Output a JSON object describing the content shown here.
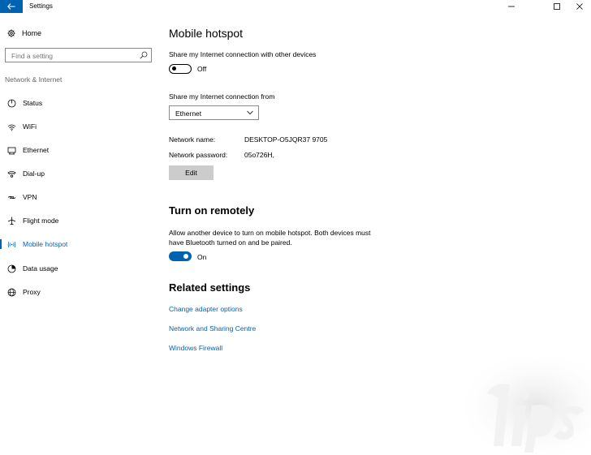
{
  "titlebar": {
    "app_title": "Settings"
  },
  "sidebar": {
    "home_label": "Home",
    "search_placeholder": "Find a setting",
    "group_label": "Network & Internet",
    "items": [
      {
        "label": "Status",
        "icon": "status-icon"
      },
      {
        "label": "WiFi",
        "icon": "wifi-icon"
      },
      {
        "label": "Ethernet",
        "icon": "ethernet-icon"
      },
      {
        "label": "Dial-up",
        "icon": "dialup-icon"
      },
      {
        "label": "VPN",
        "icon": "vpn-icon"
      },
      {
        "label": "Flight mode",
        "icon": "airplane-icon"
      },
      {
        "label": "Mobile hotspot",
        "icon": "hotspot-icon",
        "active": true
      },
      {
        "label": "Data usage",
        "icon": "data-usage-icon"
      },
      {
        "label": "Proxy",
        "icon": "globe-icon"
      }
    ]
  },
  "main": {
    "title": "Mobile hotspot",
    "share_label": "Share my Internet connection with other devices",
    "share_toggle_state": "Off",
    "share_from_label": "Share my Internet connection from",
    "share_from_value": "Ethernet",
    "network_name_key": "Network name:",
    "network_name_value": "DESKTOP-O5JQR37 9705",
    "network_password_key": "Network password:",
    "network_password_value": "05o726H,",
    "edit_label": "Edit",
    "remote_title": "Turn on remotely",
    "remote_desc": "Allow another device to turn on mobile hotspot. Both devices must have Bluetooth turned on and be paired.",
    "remote_toggle_state": "On",
    "related_title": "Related settings",
    "links": [
      "Change adapter options",
      "Network and Sharing Centre",
      "Windows Firewall"
    ]
  },
  "colors": {
    "accent": "#0063b1",
    "button_gray": "#cccccc"
  }
}
